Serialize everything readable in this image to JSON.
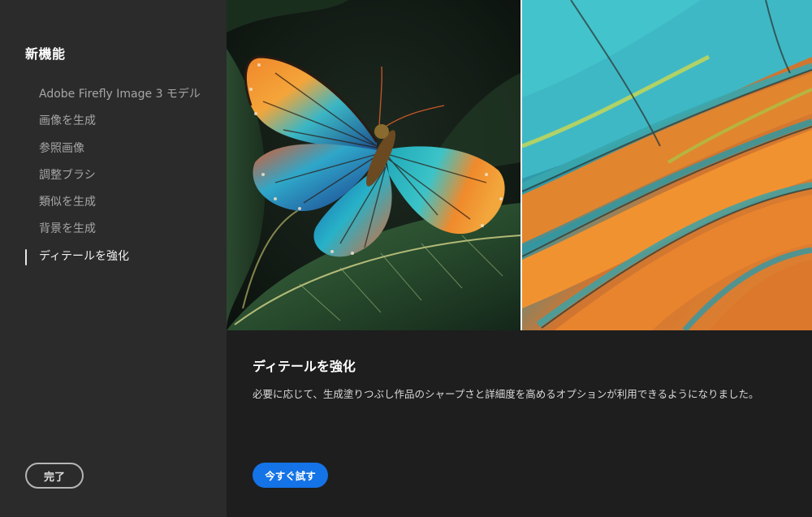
{
  "sidebar": {
    "title": "新機能",
    "items": [
      {
        "label": "Adobe Firefly Image 3 モデル"
      },
      {
        "label": "画像を生成"
      },
      {
        "label": "参照画像"
      },
      {
        "label": "調整ブラシ"
      },
      {
        "label": "類似を生成"
      },
      {
        "label": "背景を生成"
      },
      {
        "label": "ディテールを強化",
        "active": true
      }
    ],
    "done_label": "完了"
  },
  "main": {
    "title": "ディテールを強化",
    "description": "必要に応じて、生成塗りつぶし作品のシャープさと詳細度を高めるオプションが利用できるようになりました。",
    "try_label": "今すぐ試す"
  },
  "colors": {
    "sidebar_bg": "#2b2b2b",
    "main_bg": "#1e1e1e",
    "accent": "#1473e6"
  }
}
